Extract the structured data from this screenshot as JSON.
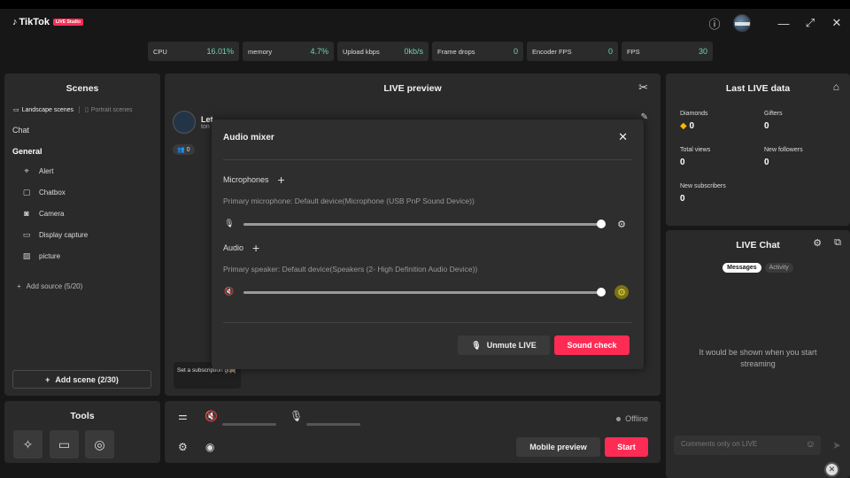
{
  "app": {
    "brand": "TikTok",
    "badge": "LIVE Studio"
  },
  "stats": [
    {
      "label": "CPU",
      "value": "16.01%"
    },
    {
      "label": "memory",
      "value": "4.7%"
    },
    {
      "label": "Upload kbps",
      "value": "0kb/s"
    },
    {
      "label": "Frame drops",
      "value": "0"
    },
    {
      "label": "Encoder FPS",
      "value": "0"
    },
    {
      "label": "FPS",
      "value": "30"
    }
  ],
  "scenes": {
    "title": "Scenes",
    "tab_landscape": "Landscape scenes",
    "tab_portrait": "Portrait scenes",
    "scene_list": [
      "Chat",
      "General"
    ],
    "sources": [
      {
        "label": "Alert",
        "icon": "alert-icon"
      },
      {
        "label": "Chatbox",
        "icon": "chatbox-icon"
      },
      {
        "label": "Camera",
        "icon": "camera-icon"
      },
      {
        "label": "Display capture",
        "icon": "display-icon"
      },
      {
        "label": "picture",
        "icon": "picture-icon"
      }
    ],
    "add_source": "Add source (5/20)",
    "add_scene": "Add scene (2/30)"
  },
  "tools": {
    "title": "Tools"
  },
  "preview": {
    "title": "LIVE preview",
    "host_name": "Let",
    "host_sub": "ton",
    "viewers": "0",
    "goal_text": "Set a subscription goal"
  },
  "mixer": {
    "title": "Audio mixer",
    "mic_heading": "Microphones",
    "mic_device": "Primary microphone: Default device(Microphone (USB PnP Sound Device))",
    "mic_level": 0.998,
    "audio_heading": "Audio",
    "audio_device": "Primary speaker: Default device(Speakers (2- High Definition Audio Device))",
    "audio_level": 0.998,
    "unmute_label": "Unmute LIVE",
    "sound_check_label": "Sound check"
  },
  "controls": {
    "status": "Offline",
    "mobile_preview": "Mobile preview",
    "start": "Start"
  },
  "last_live": {
    "title": "Last LIVE data",
    "metrics": [
      {
        "label": "Diamonds",
        "value": "0"
      },
      {
        "label": "Gifters",
        "value": "0"
      },
      {
        "label": "Total views",
        "value": "0"
      },
      {
        "label": "New followers",
        "value": "0"
      },
      {
        "label": "New subscribers",
        "value": "0"
      }
    ]
  },
  "chat": {
    "title": "LIVE Chat",
    "tab_messages": "Messages",
    "tab_activity": "Activity",
    "empty_text": "It would be shown when you start streaming",
    "input_placeholder": "Comments only on LIVE"
  },
  "colors": {
    "accent": "#fe2c55",
    "stat_value": "#6fd1b8",
    "panel": "#2a2a2a"
  }
}
